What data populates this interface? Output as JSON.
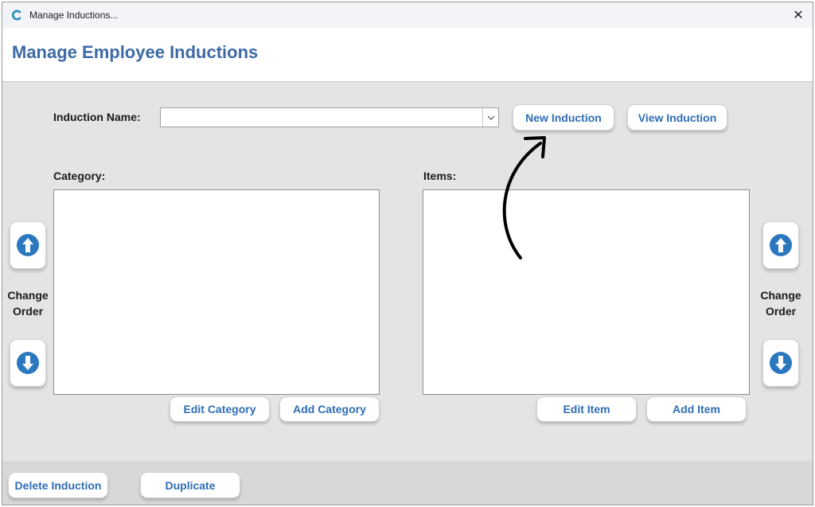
{
  "window": {
    "title": "Manage Inductions...",
    "close": "✕"
  },
  "header": {
    "title": "Manage Employee Inductions"
  },
  "form": {
    "induction_name_label": "Induction Name:",
    "induction_name_value": "",
    "new_induction": "New Induction",
    "view_induction": "View Induction"
  },
  "category": {
    "label": "Category:",
    "items": [],
    "edit": "Edit Category",
    "add": "Add Category"
  },
  "items": {
    "label": "Items:",
    "items": [],
    "edit": "Edit Item",
    "add": "Add Item"
  },
  "change_order": {
    "line1": "Change",
    "line2": "Order"
  },
  "footer": {
    "delete": "Delete Induction",
    "duplicate": "Duplicate"
  },
  "colors": {
    "accent": "#2e6db5",
    "title": "#3d6aa5",
    "arrow_icon": "#2b78bf"
  }
}
